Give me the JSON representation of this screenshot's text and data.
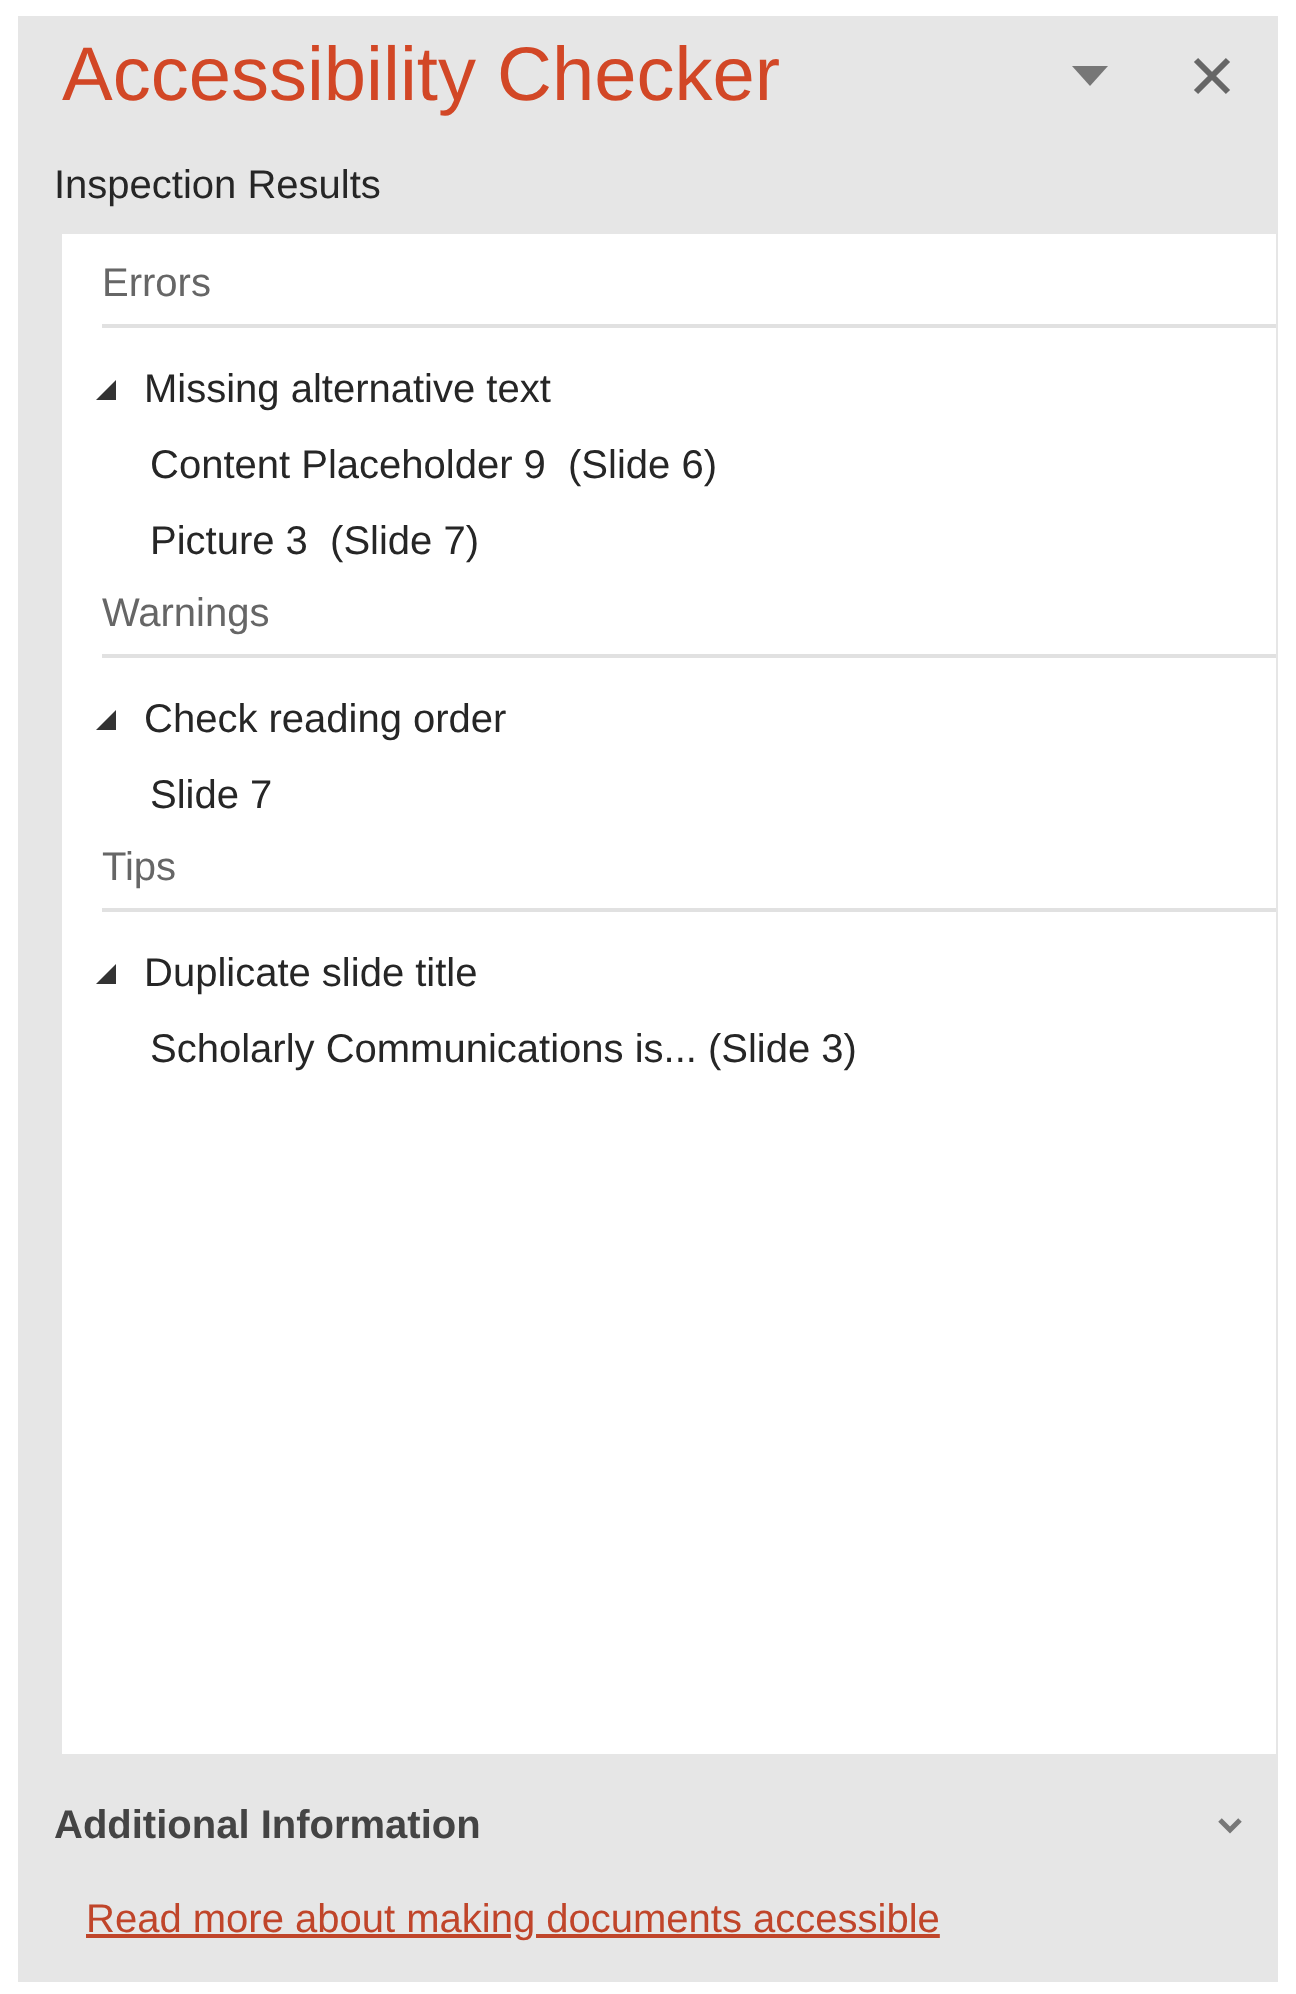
{
  "pane": {
    "title": "Accessibility Checker"
  },
  "results": {
    "label": "Inspection Results",
    "sections": [
      {
        "heading": "Errors",
        "issues": [
          {
            "title": "Missing alternative text",
            "expanded": true,
            "children": [
              {
                "label": "Content Placeholder 9  (Slide 6)"
              },
              {
                "label": "Picture 3  (Slide 7)"
              }
            ]
          }
        ]
      },
      {
        "heading": "Warnings",
        "issues": [
          {
            "title": "Check reading order",
            "expanded": true,
            "children": [
              {
                "label": "Slide 7"
              }
            ]
          }
        ]
      },
      {
        "heading": "Tips",
        "issues": [
          {
            "title": "Duplicate slide title",
            "expanded": true,
            "children": [
              {
                "label": "Scholarly Communications is... (Slide 3)"
              }
            ]
          }
        ]
      }
    ]
  },
  "additional_info": {
    "heading": "Additional Information",
    "expanded": false,
    "link": "Read more about making documents accessible"
  }
}
